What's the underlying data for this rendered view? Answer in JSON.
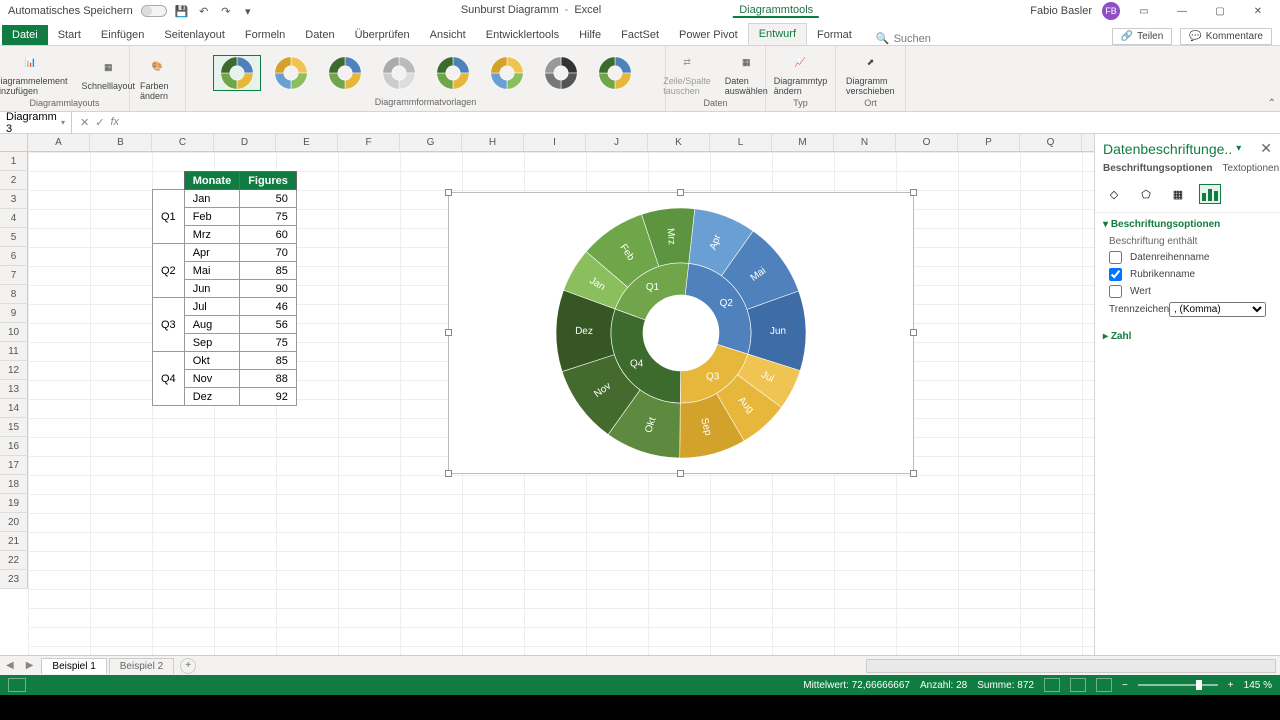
{
  "title": {
    "autosave": "Automatisches Speichern",
    "doc": "Sunburst Diagramm",
    "app": "Excel",
    "context": "Diagrammtools",
    "user": "Fabio Basler",
    "initials": "FB"
  },
  "tabs": {
    "datei": "Datei",
    "list": [
      "Start",
      "Einfügen",
      "Seitenlayout",
      "Formeln",
      "Daten",
      "Überprüfen",
      "Ansicht",
      "Entwicklertools",
      "Hilfe",
      "FactSet",
      "Power Pivot",
      "Entwurf",
      "Format"
    ],
    "active": "Entwurf",
    "search": "Suchen",
    "share": "Teilen",
    "comments": "Kommentare"
  },
  "ribbon": {
    "groups": {
      "layouts": {
        "label": "Diagrammlayouts",
        "btn1": "Diagrammelement hinzufügen",
        "btn2": "Schnelllayout"
      },
      "colors": {
        "btn": "Farben ändern"
      },
      "styles": {
        "label": "Diagrammformatvorlagen"
      },
      "data": {
        "label": "Daten",
        "btn1": "Zeile/Spalte tauschen",
        "btn2": "Daten auswählen"
      },
      "type": {
        "label": "Typ",
        "btn": "Diagrammtyp ändern"
      },
      "loc": {
        "label": "Ort",
        "btn": "Diagramm verschieben"
      }
    }
  },
  "namebox": "Diagramm 3",
  "columns": [
    "A",
    "B",
    "C",
    "D",
    "E",
    "F",
    "G",
    "H",
    "I",
    "J",
    "K",
    "L",
    "M",
    "N",
    "O",
    "P",
    "Q"
  ],
  "rows": 23,
  "table": {
    "headers": [
      "Monate",
      "Figures"
    ],
    "quarters": [
      "Q1",
      "Q2",
      "Q3",
      "Q4"
    ],
    "rows": [
      {
        "m": "Jan",
        "v": 50
      },
      {
        "m": "Feb",
        "v": 75
      },
      {
        "m": "Mrz",
        "v": 60
      },
      {
        "m": "Apr",
        "v": 70
      },
      {
        "m": "Mai",
        "v": 85
      },
      {
        "m": "Jun",
        "v": 90
      },
      {
        "m": "Jul",
        "v": 46
      },
      {
        "m": "Aug",
        "v": 56
      },
      {
        "m": "Sep",
        "v": 75
      },
      {
        "m": "Okt",
        "v": 85
      },
      {
        "m": "Nov",
        "v": 88
      },
      {
        "m": "Dez",
        "v": 92
      }
    ]
  },
  "chart_data": {
    "type": "sunburst",
    "inner": [
      {
        "label": "Q1",
        "color": "#70a54a",
        "children": [
          0,
          1,
          2
        ]
      },
      {
        "label": "Q2",
        "color": "#4f81bd",
        "children": [
          3,
          4,
          5
        ]
      },
      {
        "label": "Q3",
        "color": "#e6b73a",
        "children": [
          6,
          7,
          8
        ]
      },
      {
        "label": "Q4",
        "color": "#3d6b2e",
        "children": [
          9,
          10,
          11
        ]
      }
    ],
    "outer": [
      {
        "label": "Jan",
        "v": 50,
        "color": "#8bbf5e"
      },
      {
        "label": "Feb",
        "v": 75,
        "color": "#6fa64a"
      },
      {
        "label": "Mrz",
        "v": 60,
        "color": "#5c9440"
      },
      {
        "label": "Apr",
        "v": 70,
        "color": "#6a9fd4"
      },
      {
        "label": "Mai",
        "v": 85,
        "color": "#4f81bd"
      },
      {
        "label": "Jun",
        "v": 90,
        "color": "#3e6ca6"
      },
      {
        "label": "Jul",
        "v": 46,
        "color": "#f0c452"
      },
      {
        "label": "Aug",
        "v": 56,
        "color": "#e6b73a"
      },
      {
        "label": "Sep",
        "v": 75,
        "color": "#d3a22a"
      },
      {
        "label": "Okt",
        "v": 85,
        "color": "#5e8a3f"
      },
      {
        "label": "Nov",
        "v": 88,
        "color": "#456a2e"
      },
      {
        "label": "Dez",
        "v": 92,
        "color": "#365724"
      }
    ]
  },
  "pane": {
    "title": "Datenbeschriftunge..",
    "sub1": "Beschriftungsoptionen",
    "sub2": "Textoptionen",
    "section1": "Beschriftungsoptionen",
    "contains": "Beschriftung enthält",
    "opt_series": "Datenreihenname",
    "opt_cat": "Rubrikenname",
    "opt_val": "Wert",
    "sep_label": "Trennzeichen",
    "sep_value": ", (Komma)",
    "section2": "Zahl"
  },
  "sheets": {
    "s1": "Beispiel 1",
    "s2": "Beispiel 2"
  },
  "status": {
    "mean_l": "Mittelwert:",
    "mean_v": "72,66666667",
    "count_l": "Anzahl:",
    "count_v": "28",
    "sum_l": "Summe:",
    "sum_v": "872",
    "zoom": "145 %"
  }
}
